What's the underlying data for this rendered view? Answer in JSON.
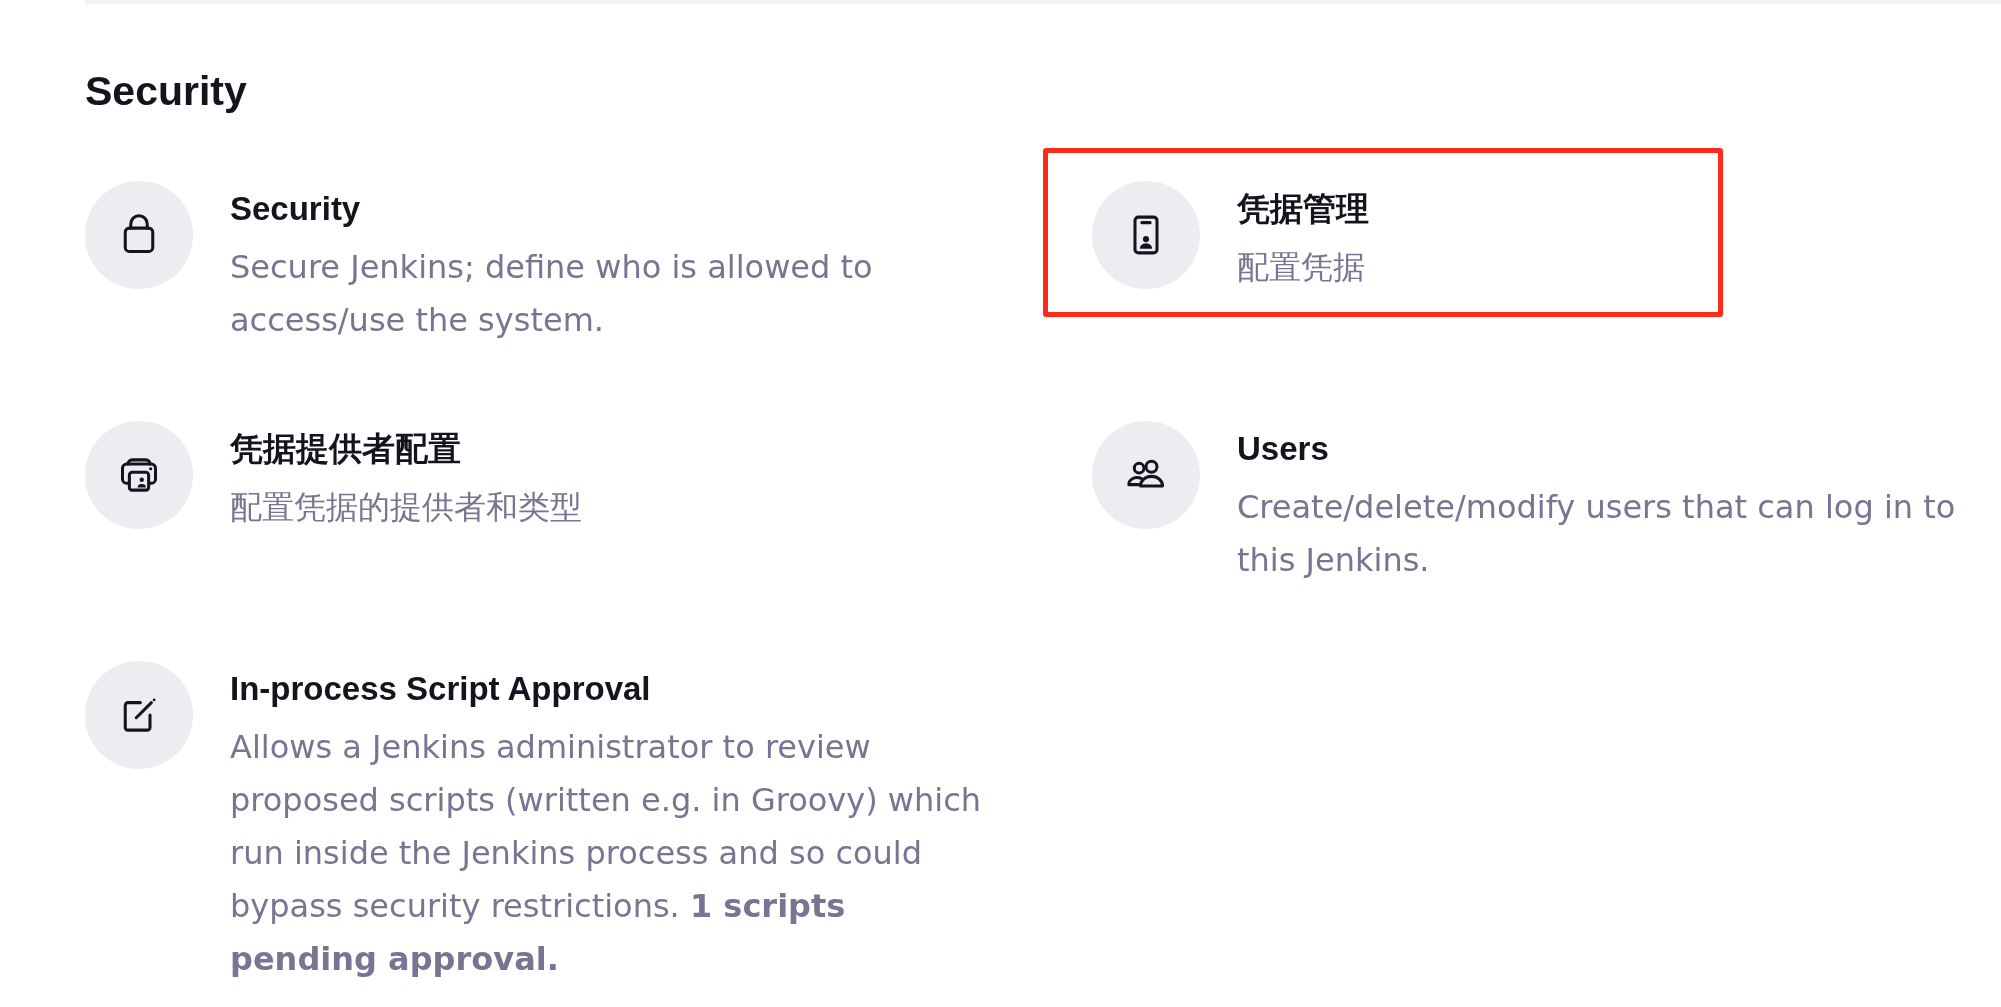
{
  "section": {
    "title": "Security"
  },
  "items": [
    {
      "title": "Security",
      "description": "Secure Jenkins; define who is allowed to access/use the system.",
      "highlighted": false
    },
    {
      "title": "凭据管理",
      "description": "配置凭据",
      "highlighted": true
    },
    {
      "title": "凭据提供者配置",
      "description": "配置凭据的提供者和类型",
      "highlighted": false
    },
    {
      "title": "Users",
      "description": "Create/delete/modify users that can log in to this Jenkins.",
      "highlighted": false
    },
    {
      "title": "In-process Script Approval",
      "description": "Allows a Jenkins administrator to review proposed scripts (written e.g. in Groovy) which run inside the Jenkins process and so could bypass security restrictions. **1 scripts pending approval.**",
      "highlighted": false
    }
  ]
}
